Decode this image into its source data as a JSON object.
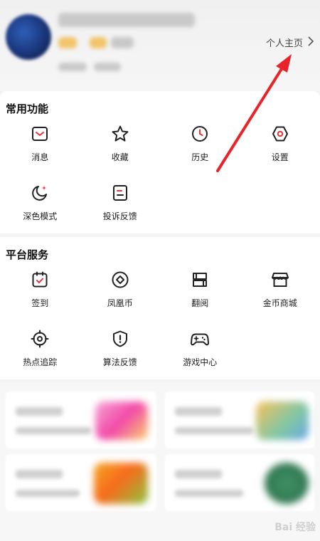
{
  "header": {
    "profile_link_label": "个人主页"
  },
  "common": {
    "title": "常用功能",
    "items": [
      {
        "label": "消息",
        "icon": "message-icon"
      },
      {
        "label": "收藏",
        "icon": "star-icon"
      },
      {
        "label": "历史",
        "icon": "clock-icon"
      },
      {
        "label": "设置",
        "icon": "settings-icon"
      },
      {
        "label": "深色模式",
        "icon": "moon-icon"
      },
      {
        "label": "投诉反馈",
        "icon": "feedback-icon"
      }
    ]
  },
  "platform": {
    "title": "平台服务",
    "items": [
      {
        "label": "签到",
        "icon": "checkin-icon"
      },
      {
        "label": "凤凰币",
        "icon": "coin-icon"
      },
      {
        "label": "翻阅",
        "icon": "book-icon"
      },
      {
        "label": "金币商城",
        "icon": "store-icon"
      },
      {
        "label": "热点追踪",
        "icon": "target-icon"
      },
      {
        "label": "算法反馈",
        "icon": "shield-icon"
      },
      {
        "label": "游戏中心",
        "icon": "gamepad-icon"
      }
    ]
  },
  "watermark": "Bai 经验",
  "colors": {
    "accent": "#e8333a",
    "annotation_arrow": "#e8242a"
  }
}
